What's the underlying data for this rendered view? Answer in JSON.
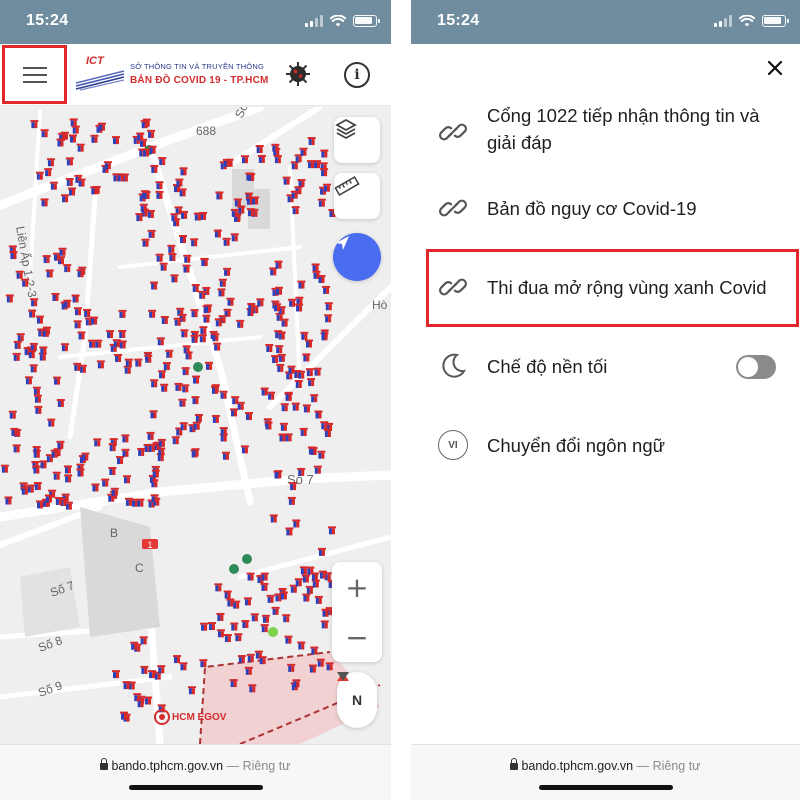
{
  "status_bar": {
    "left_time": "15:24",
    "right_time": "15:24"
  },
  "map_screen": {
    "header": {
      "logo_ict": "ICT",
      "logo_org": "SỞ THÔNG TIN VÀ TRUYỀN THÔNG",
      "logo_title": "BẢN ĐỒ  COVID 19 - TP.HCM",
      "info_icon": "info-icon",
      "menu_icon": "hamburger-menu-icon",
      "virus_icon": "virus-icon"
    },
    "map_labels": {
      "road_688": "688",
      "road_so_top": "Số",
      "road_lien_ap": "Liên Ấp 1-2-3",
      "road_so7_center": "Số 7",
      "road_ho": "Hò",
      "block_b": "B",
      "block_c": "C",
      "road_so7_left": "Số 7",
      "road_so8": "Số 8",
      "road_so9": "Số 9",
      "route_marker": "1"
    },
    "controls": {
      "zoom_in": "+",
      "zoom_out": "−",
      "compass_n": "N",
      "egov_label": "HCM EGOV"
    },
    "url": {
      "domain": "bando.tphcm.gov.vn",
      "suffix": "— Riêng tư"
    }
  },
  "menu_screen": {
    "items": [
      {
        "label": "Cổng 1022 tiếp nhận thông tin và giải đáp",
        "icon": "link-icon"
      },
      {
        "label": "Bản đồ nguy cơ Covid-19",
        "icon": "link-icon"
      },
      {
        "label": "Thi đua mở rộng vùng xanh Covid",
        "icon": "link-icon"
      },
      {
        "label": "Chế độ nền tối",
        "icon": "moon-icon",
        "toggle": "off"
      },
      {
        "label": "Chuyển đổi ngôn ngữ",
        "icon": "language-icon",
        "badge": "VI"
      }
    ],
    "url": {
      "domain": "bando.tphcm.gov.vn",
      "suffix": "— Riêng tư"
    }
  },
  "colors": {
    "status_bar": "#6f8d9e",
    "highlight": "#e1272b",
    "locate_button": "#4a6cf0",
    "marker_blue": "#2f3fb8",
    "marker_red": "#d62828"
  }
}
